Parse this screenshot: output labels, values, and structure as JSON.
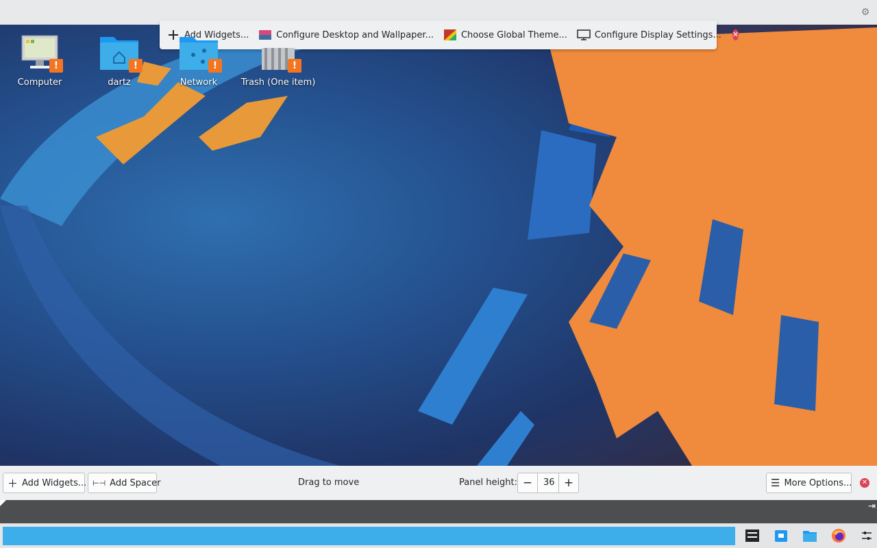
{
  "desktop_toolbox": {
    "items": [
      {
        "label": "Add Widgets...",
        "icon": "plus-icon"
      },
      {
        "label": "Configure Desktop and Wallpaper...",
        "icon": "desktop-wallpaper-icon"
      },
      {
        "label": "Choose Global Theme...",
        "icon": "global-theme-icon"
      },
      {
        "label": "Configure Display Settings...",
        "icon": "display-icon"
      }
    ],
    "close_icon": "close-icon"
  },
  "desktop_icons": [
    {
      "label": "Computer",
      "icon": "computer-icon"
    },
    {
      "label": "dartz",
      "icon": "home-folder-icon"
    },
    {
      "label": "Network",
      "icon": "network-folder-icon"
    },
    {
      "label": "Trash (One item)",
      "icon": "trash-icon"
    }
  ],
  "warning_badge": "!",
  "panel_config": {
    "add_widgets": "Add Widgets...",
    "add_spacer": "Add Spacer",
    "drag_to_move": "Drag to move",
    "panel_height_label": "Panel height:",
    "panel_height_value": "36",
    "more_options": "More Options..."
  },
  "panel": {
    "tray_icons": [
      "system-settings-icon",
      "discover-icon",
      "file-manager-icon",
      "firefox-icon",
      "panel-settings-icon"
    ]
  },
  "colors": {
    "accent": "#3daee9",
    "warning": "#f47521",
    "close": "#da4453",
    "panel_bg": "#e3e5e7"
  }
}
